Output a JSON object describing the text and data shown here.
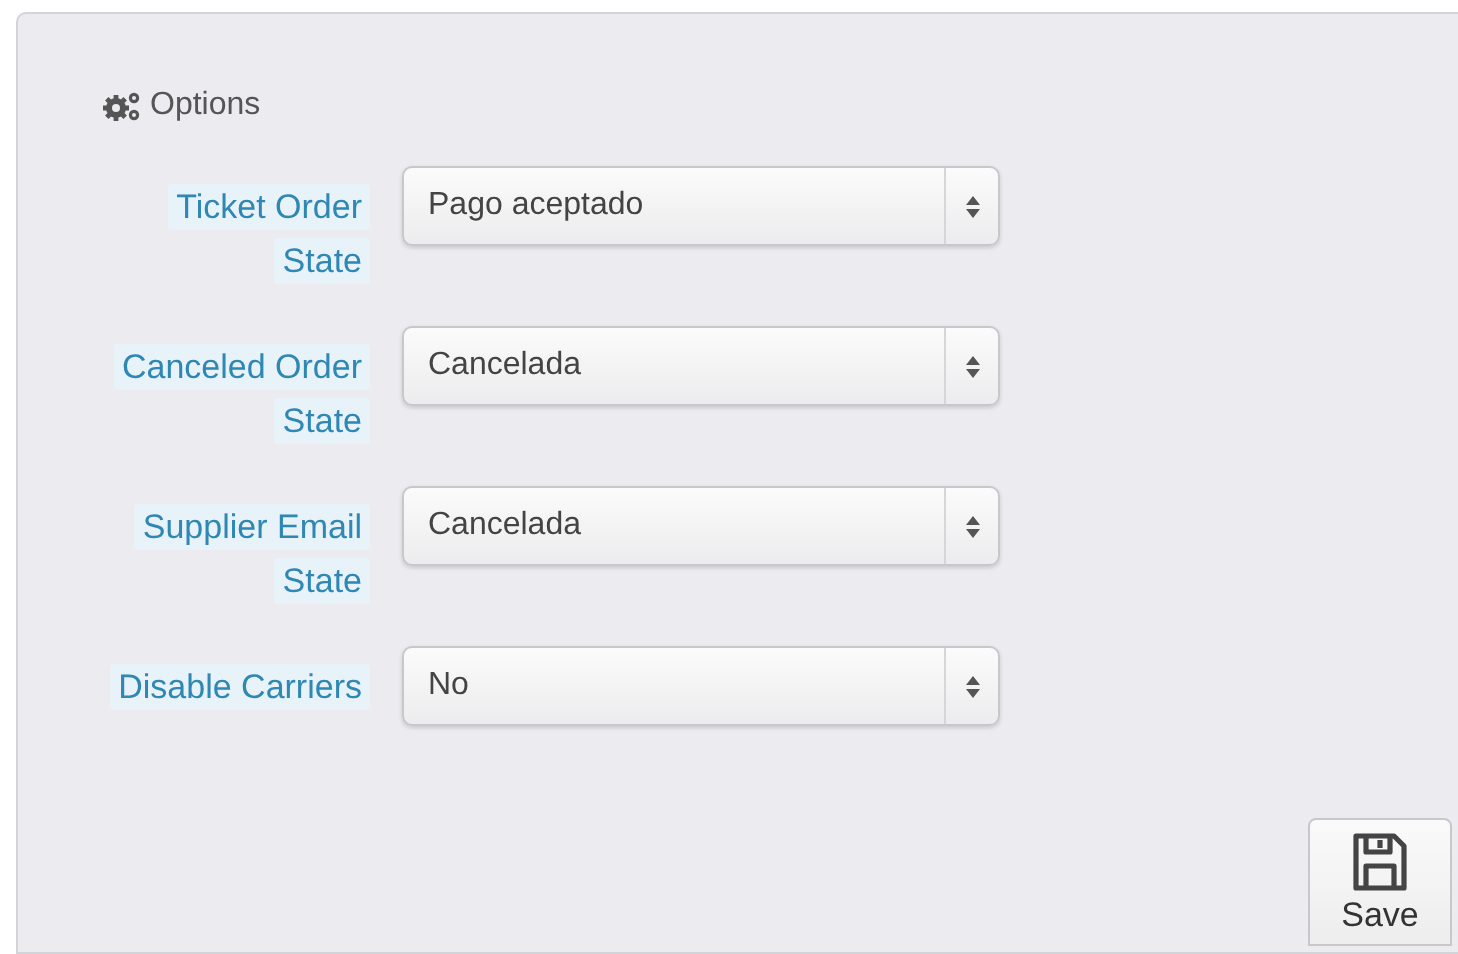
{
  "panel": {
    "title": "Options"
  },
  "fields": [
    {
      "label": "Ticket Order\nState",
      "value": "Pago aceptado"
    },
    {
      "label": "Canceled Order\nState",
      "value": "Cancelada"
    },
    {
      "label": "Supplier Email\nState",
      "value": "Cancelada"
    },
    {
      "label": "Disable Carriers",
      "value": "No"
    }
  ],
  "save_button": {
    "label": "Save"
  }
}
